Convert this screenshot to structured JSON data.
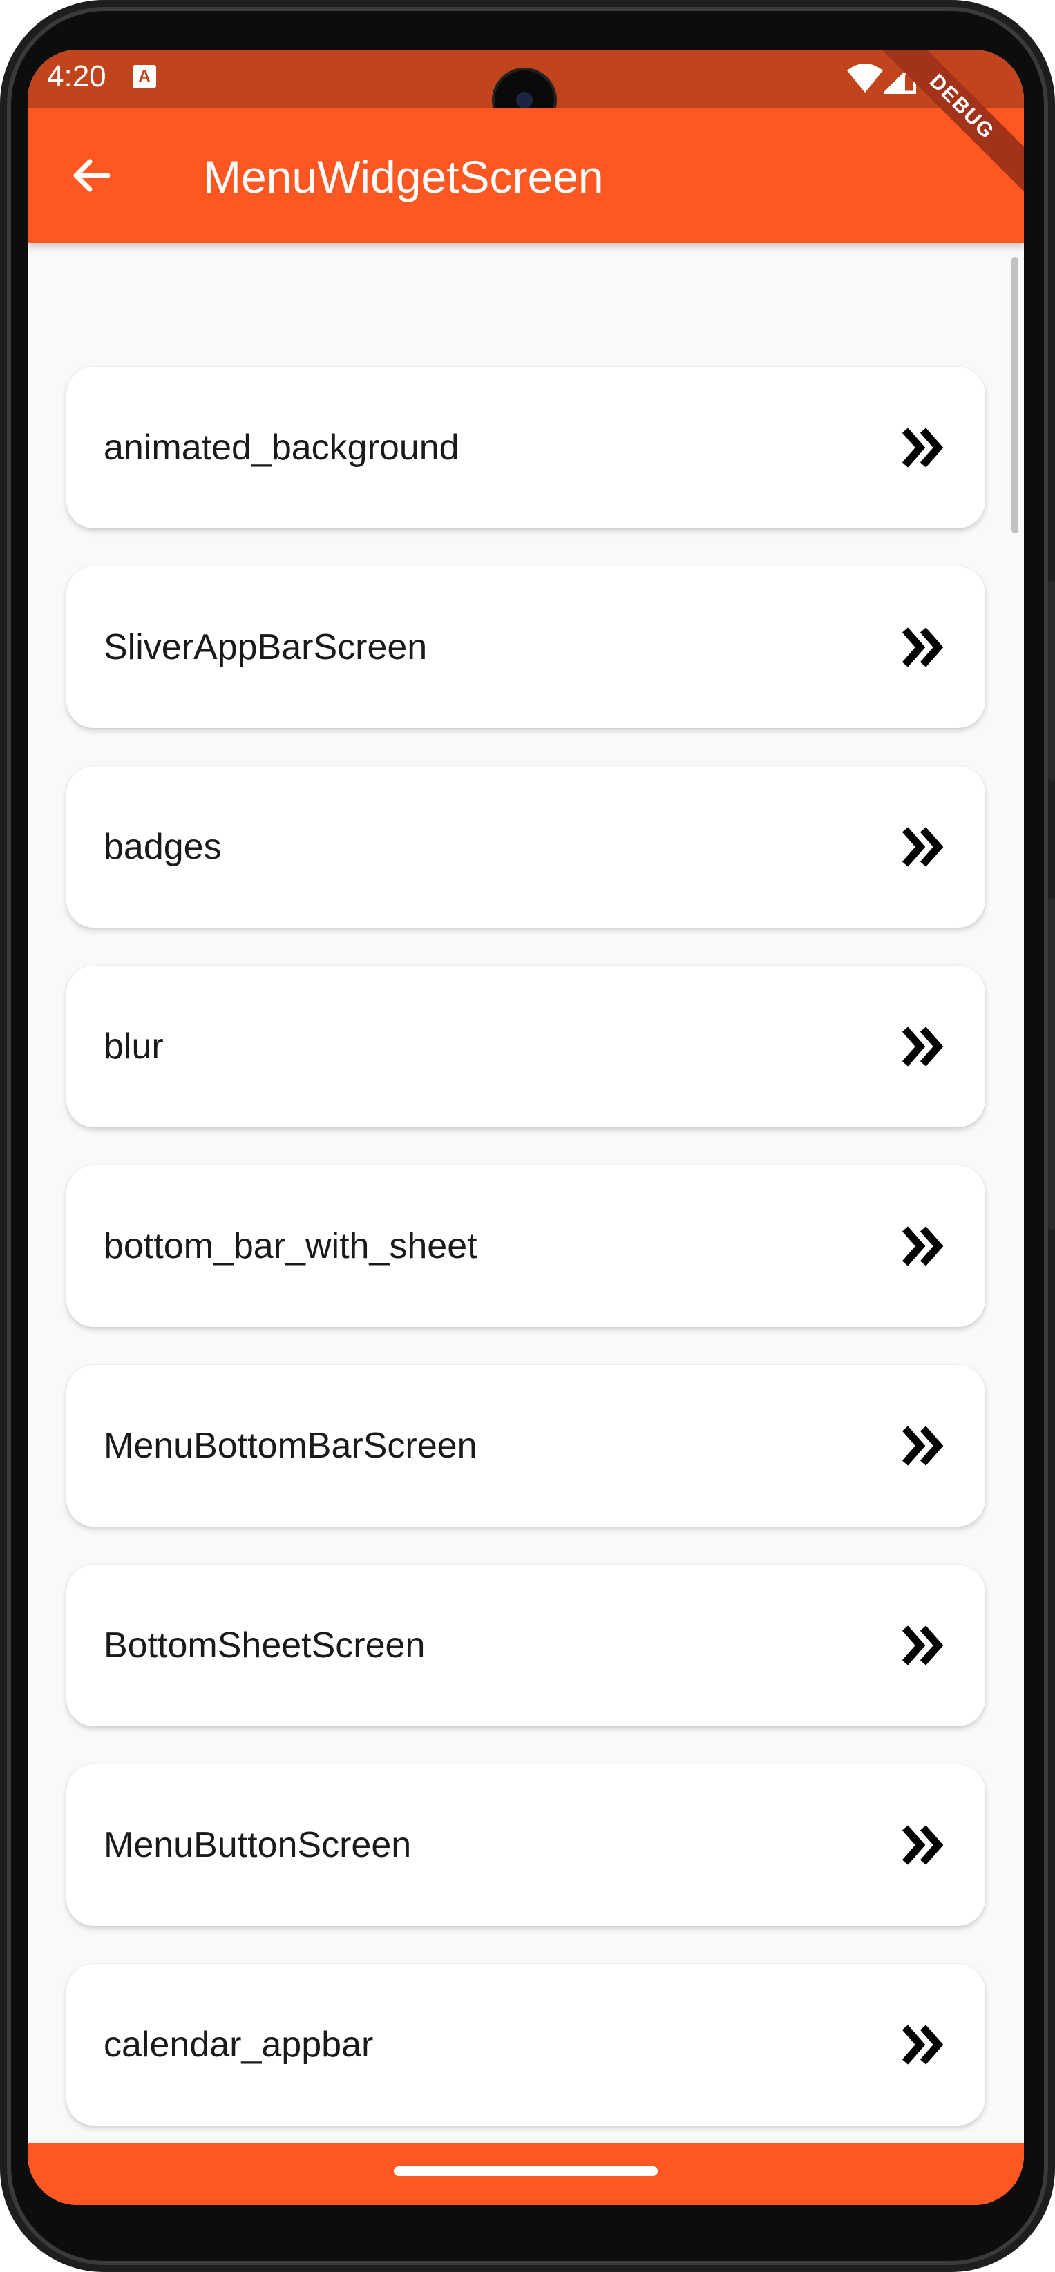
{
  "status_bar": {
    "time": "4:20",
    "notification_icon": "A",
    "icons": [
      "wifi-icon",
      "signal-icon"
    ]
  },
  "debug_banner": "DEBUG",
  "app_bar": {
    "title": "MenuWidgetScreen",
    "back_icon": "arrow-left-icon",
    "color": "#ff5722"
  },
  "menu": {
    "items": [
      {
        "label": "animated_background"
      },
      {
        "label": "SliverAppBarScreen"
      },
      {
        "label": "badges"
      },
      {
        "label": "blur"
      },
      {
        "label": "bottom_bar_with_sheet"
      },
      {
        "label": "MenuBottomBarScreen"
      },
      {
        "label": "BottomSheetScreen"
      },
      {
        "label": "MenuButtonScreen"
      },
      {
        "label": "calendar_appbar"
      },
      {
        "label": ""
      }
    ],
    "item_icon": "double-chevron-right-icon"
  },
  "colors": {
    "accent": "#ff5722",
    "status_bar": "#c1441d",
    "background": "#f9f9f9"
  }
}
